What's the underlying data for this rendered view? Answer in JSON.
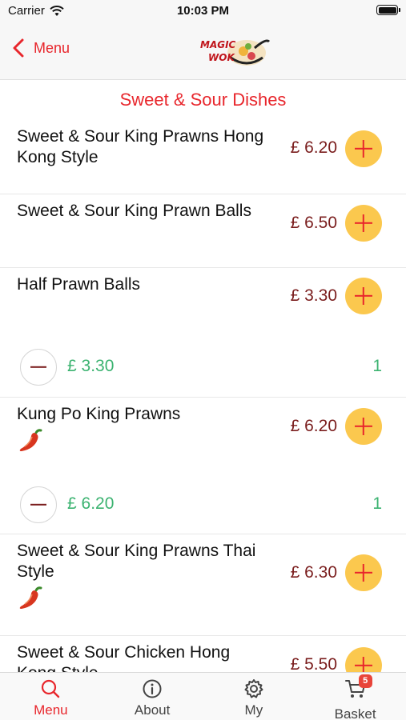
{
  "status_bar": {
    "carrier": "Carrier",
    "time": "10:03 PM"
  },
  "nav": {
    "back_label": "Menu",
    "logo_text_top": "MAGIC",
    "logo_text_bottom": "WOK"
  },
  "section_title": "Sweet & Sour Dishes",
  "items": [
    {
      "name": "Sweet & Sour King Prawns Hong Kong Style",
      "price": "£ 6.20",
      "spicy": false
    },
    {
      "name": "Sweet & Sour King Prawn Balls",
      "price": "£ 6.50",
      "spicy": false
    },
    {
      "name": "Half Prawn Balls",
      "price": "£ 3.30",
      "spicy": false,
      "line_total": "£ 3.30",
      "quantity": "1"
    },
    {
      "name": "Kung Po King Prawns",
      "price": "£ 6.20",
      "spicy": true,
      "line_total": "£ 6.20",
      "quantity": "1"
    },
    {
      "name": "Sweet & Sour King Prawns Thai Style",
      "price": "£ 6.30",
      "spicy": true
    },
    {
      "name": "Sweet & Sour Chicken Hong Kong Style",
      "price": "£ 5.50",
      "spicy": false
    }
  ],
  "tabs": [
    {
      "label": "Menu",
      "icon": "search-icon",
      "active": true
    },
    {
      "label": "About",
      "icon": "info-icon",
      "active": false
    },
    {
      "label": "My",
      "icon": "gear-icon",
      "active": false
    },
    {
      "label": "Basket",
      "icon": "cart-icon",
      "active": false,
      "badge": "5"
    }
  ],
  "colors": {
    "accent": "#e8262c",
    "price": "#7a1d1d",
    "add_button": "#fbc84e",
    "quantity": "#3cb371"
  }
}
